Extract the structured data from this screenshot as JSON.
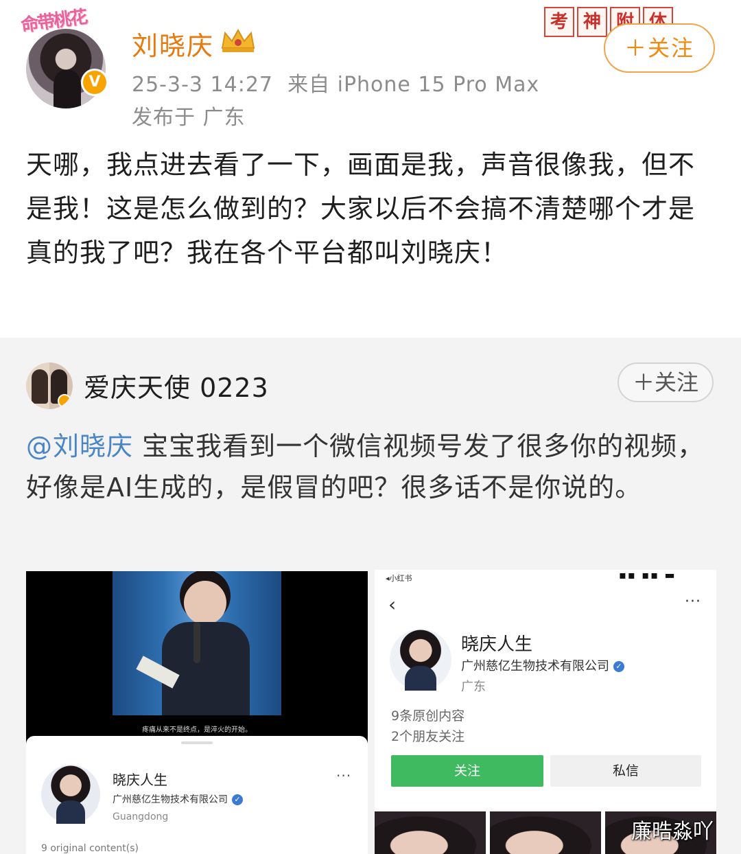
{
  "post": {
    "avatar_frame_text": "命带桃花",
    "username": "刘晓庆",
    "timestamp": "25-3-3 14:27",
    "source": "来自 iPhone 15 Pro Max",
    "location": "发布于 广东",
    "follow_label": "＋关注",
    "stamps": [
      "考",
      "神",
      "附",
      "体"
    ],
    "body": "天哪，我点进去看了一下，画面是我，声音很像我，但不是我！这是怎么做到的？大家以后不会搞不清楚哪个才是真的我了吧？我在各个平台都叫刘晓庆！",
    "accent_color": "#e8790e"
  },
  "repost": {
    "username": "爱庆天使 0223",
    "follow_label": "＋关注",
    "mention": "@刘晓庆",
    "body": " 宝宝我看到一个微信视频号发了很多你的视频，好像是AI生成的，是假冒的吧？很多话不是你说的。",
    "mention_color": "#4a86c7"
  },
  "left_screenshot": {
    "subtitle": "疼痛从来不是终点，是淬火的开始。",
    "account_name": "晓庆人生",
    "company": "广州慈亿生物技术有限公司",
    "location": "Guangdong",
    "count": "9 original content(s)",
    "more": "···"
  },
  "right_screenshot": {
    "status_left": "◂小红书",
    "status_right": "▪▪ ▪▪ ▬",
    "back_icon": "‹",
    "more": "···",
    "account_name": "晓庆人生",
    "company": "广州慈亿生物技术有限公司",
    "location": "广东",
    "original_count": "9条原创内容",
    "friends_follow": "2个朋友关注",
    "follow_button": "关注",
    "message_button": "私信",
    "follow_color": "#3fba60"
  },
  "watermark": "廉晧淼吖"
}
